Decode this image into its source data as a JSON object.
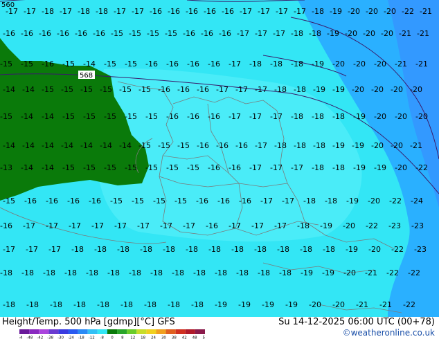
{
  "title": {
    "parameter": "Height/Temp. 500 hPa [gdmp][°C] GFS",
    "valid": "Su 14-12-2025 06:00 UTC (00+78)",
    "credit": "©weatheronline.co.uk"
  },
  "colors": {
    "land_green": "#0a7a0a",
    "cyan": "#33e6f5",
    "cyan_light": "#5cf0fa",
    "blue_mid": "#2ab0ff",
    "blue_deep": "#3399ff",
    "contour": "#3a1a6a",
    "border": "#7a7a7a"
  },
  "height_contours": [
    {
      "label": "560"
    },
    {
      "label": "568"
    }
  ],
  "temp_rows": [
    {
      "labels": [
        "-17",
        "-17",
        "-18",
        "-17",
        "-18",
        "-18",
        "-17",
        "-17",
        "-16",
        "-16",
        "-16",
        "-16",
        "-16",
        "-17",
        "-17",
        "-17",
        "-17",
        "-18",
        "-19",
        "-20",
        "-20",
        "-20",
        "-22",
        "-21"
      ]
    },
    {
      "labels": [
        "-16",
        "-16",
        "-16",
        "-16",
        "-16",
        "-16",
        "-15",
        "-15",
        "-15",
        "-15",
        "-16",
        "-16",
        "-16",
        "-17",
        "-17",
        "-17",
        "-18",
        "-18",
        "-19",
        "-20",
        "-20",
        "-20",
        "-21",
        "-21"
      ]
    },
    {
      "labels": [
        "-15",
        "-15",
        "-16",
        "-15",
        "-14",
        "-15",
        "-15",
        "-16",
        "-16",
        "-16",
        "-16",
        "-17",
        "-18",
        "-18",
        "-18",
        "-19",
        "-20",
        "-20",
        "-20",
        "-21",
        "-21"
      ]
    },
    {
      "labels": [
        "-14",
        "-14",
        "-15",
        "-15",
        "-15",
        "-15",
        "-15",
        "-15",
        "-16",
        "-16",
        "-16",
        "-17",
        "-17",
        "-17",
        "-18",
        "-18",
        "-19",
        "-19",
        "-20",
        "-20",
        "-20",
        "-20"
      ]
    },
    {
      "labels": [
        "-15",
        "-14",
        "-14",
        "-15",
        "-15",
        "-15",
        "-15",
        "-15",
        "-16",
        "-16",
        "-16",
        "-17",
        "-17",
        "-17",
        "-18",
        "-18",
        "-18",
        "-19",
        "-20",
        "-20",
        "-20"
      ]
    },
    {
      "labels": [
        "-14",
        "-14",
        "-14",
        "-14",
        "-14",
        "-14",
        "-14",
        "-15",
        "-15",
        "-15",
        "-16",
        "-16",
        "-16",
        "-17",
        "-18",
        "-18",
        "-18",
        "-19",
        "-19",
        "-20",
        "-20",
        "-21"
      ]
    },
    {
      "labels": [
        "-13",
        "-14",
        "-14",
        "-15",
        "-15",
        "-15",
        "-15",
        "-15",
        "-15",
        "-15",
        "-16",
        "-16",
        "-17",
        "-17",
        "-17",
        "-18",
        "-18",
        "-19",
        "-19",
        "-20",
        "-22"
      ]
    },
    {
      "labels": [
        "-15",
        "-16",
        "-16",
        "-16",
        "-16",
        "-15",
        "-15",
        "-15",
        "-15",
        "-16",
        "-16",
        "-16",
        "-17",
        "-17",
        "-18",
        "-18",
        "-19",
        "-20",
        "-22",
        "-24"
      ]
    },
    {
      "labels": [
        "-16",
        "-17",
        "-17",
        "-17",
        "-17",
        "-17",
        "-17",
        "-17",
        "-17",
        "-16",
        "-17",
        "-17",
        "-17",
        "-18",
        "-19",
        "-20",
        "-22",
        "-23",
        "-23"
      ]
    },
    {
      "labels": [
        "-17",
        "-17",
        "-17",
        "-18",
        "-18",
        "-18",
        "-18",
        "-18",
        "-18",
        "-18",
        "-18",
        "-18",
        "-18",
        "-18",
        "-18",
        "-19",
        "-20",
        "-22",
        "-23"
      ]
    },
    {
      "labels": [
        "-18",
        "-18",
        "-18",
        "-18",
        "-18",
        "-18",
        "-18",
        "-18",
        "-18",
        "-18",
        "-18",
        "-18",
        "-18",
        "-18",
        "-19",
        "-19",
        "-20",
        "-21",
        "-22",
        "-22"
      ]
    },
    {
      "labels": [
        "-18",
        "-18",
        "-18",
        "-18",
        "-18",
        "-18",
        "-18",
        "-18",
        "-18",
        "-19",
        "-19",
        "-19",
        "-19",
        "-20",
        "-20",
        "-21",
        "-21",
        "-22"
      ]
    }
  ],
  "color_scale": {
    "ticks": [
      "-54",
      "-48",
      "-42",
      "-38",
      "-30",
      "-24",
      "-18",
      "-12",
      "-8",
      "0",
      "8",
      "12",
      "18",
      "24",
      "30",
      "38",
      "42",
      "48",
      "54"
    ],
    "colors": [
      "#6a1a9a",
      "#8a2ac0",
      "#aa44dd",
      "#6a3ad0",
      "#3a3ae0",
      "#2a5af0",
      "#2a8af5",
      "#33c0f5",
      "#33e6f5",
      "#0a7a0a",
      "#2aa52a",
      "#6acc2a",
      "#c8dd2a",
      "#f0d020",
      "#f0a020",
      "#e06020",
      "#d03020",
      "#b01a2a",
      "#8a1a4a"
    ]
  }
}
